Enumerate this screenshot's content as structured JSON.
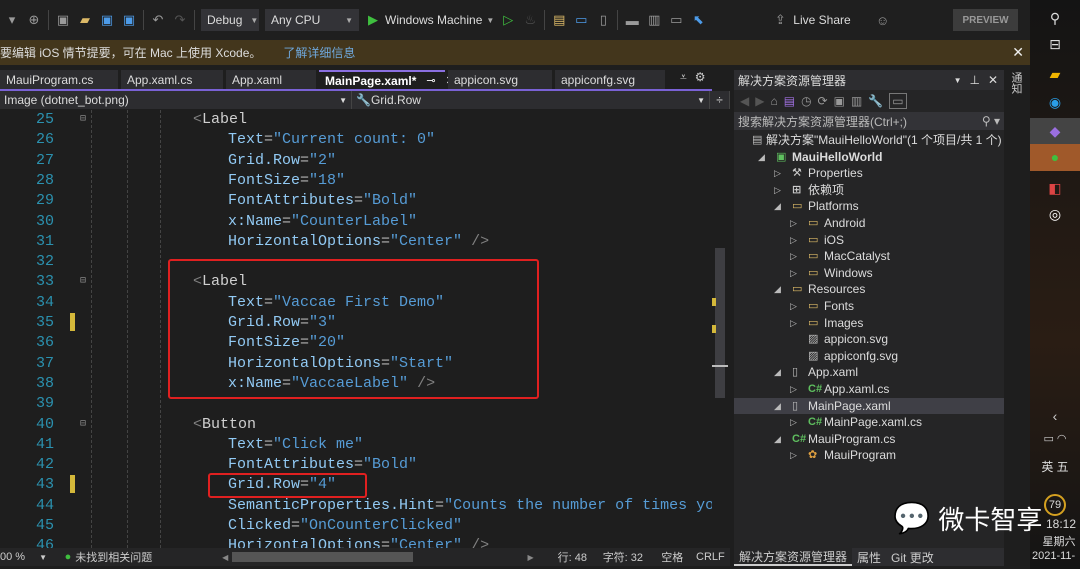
{
  "toolbar": {
    "config": "Debug",
    "platform": "Any CPU",
    "run_target": "Windows Machine",
    "live_share": "Live Share",
    "preview": "PREVIEW"
  },
  "infobar": {
    "message": "要编辑 iOS 情节提要，可在 Mac 上使用 Xcode。",
    "link": "了解详细信息"
  },
  "tabs": [
    {
      "label": "MauiProgram.cs"
    },
    {
      "label": "App.xaml.cs"
    },
    {
      "label": "App.xaml"
    },
    {
      "label": "MainPage.xaml*",
      "active": true
    },
    {
      "label": "appicon.svg"
    },
    {
      "label": "appiconfg.svg"
    }
  ],
  "navbar": {
    "element": "Image (dotnet_bot.png)",
    "member": "Grid.Row"
  },
  "code": [
    {
      "n": "25",
      "tag": "Label",
      "fold": true
    },
    {
      "n": "26",
      "attr": "Text",
      "val": "\"Current count: 0\""
    },
    {
      "n": "27",
      "attr": "Grid.Row",
      "val": "\"2\""
    },
    {
      "n": "28",
      "attr": "FontSize",
      "val": "\"18\""
    },
    {
      "n": "29",
      "attr": "FontAttributes",
      "val": "\"Bold\""
    },
    {
      "n": "30",
      "attr": "x:Name",
      "val": "\"CounterLabel\""
    },
    {
      "n": "31",
      "attr": "HorizontalOptions",
      "val": "\"Center\"",
      "close": " />"
    },
    {
      "n": "32"
    },
    {
      "n": "33",
      "tag": "Label",
      "fold": true
    },
    {
      "n": "34",
      "attr": "Text",
      "val": "\"Vaccae First Demo\""
    },
    {
      "n": "35",
      "attr": "Grid.Row",
      "val": "\"3\"",
      "changed": true
    },
    {
      "n": "36",
      "attr": "FontSize",
      "val": "\"20\""
    },
    {
      "n": "37",
      "attr": "HorizontalOptions",
      "val": "\"Start\""
    },
    {
      "n": "38",
      "attr": "x:Name",
      "val": "\"VaccaeLabel\"",
      "close": " />"
    },
    {
      "n": "39"
    },
    {
      "n": "40",
      "tag": "Button",
      "fold": true
    },
    {
      "n": "41",
      "attr": "Text",
      "val": "\"Click me\""
    },
    {
      "n": "42",
      "attr": "FontAttributes",
      "val": "\"Bold\""
    },
    {
      "n": "43",
      "attr": "Grid.Row",
      "val": "\"4\"",
      "changed": true
    },
    {
      "n": "44",
      "attr": "SemanticProperties.Hint",
      "val": "\"Counts the number of times you"
    },
    {
      "n": "45",
      "attr": "Clicked",
      "val": "\"OnCounterClicked\""
    },
    {
      "n": "46",
      "attr": "HorizontalOptions",
      "val": "\"Center\"",
      "close": " />"
    }
  ],
  "status": {
    "zoom": "00 %",
    "issues": "未找到相关问题",
    "line": "行: 48",
    "char": "字符: 32",
    "spaces": "空格",
    "eol": "CRLF"
  },
  "solution_explorer": {
    "title": "解决方案资源管理器",
    "search_placeholder": "搜索解决方案资源管理器(Ctrl+;)",
    "items": [
      {
        "label": "解决方案\"MauiHelloWorld\"(1 个项目/共 1 个)",
        "level": 0,
        "icon": "solution-icon",
        "exp": ""
      },
      {
        "label": "MauiHelloWorld",
        "level": 0,
        "icon": "csproj-icon",
        "exp": "open",
        "bold": true
      },
      {
        "label": "Properties",
        "level": 1,
        "icon": "properties-icon",
        "exp": "closed"
      },
      {
        "label": "依赖项",
        "level": 1,
        "icon": "dependencies-icon",
        "exp": "closed"
      },
      {
        "label": "Platforms",
        "level": 1,
        "icon": "folder-open-icon",
        "exp": "open"
      },
      {
        "label": "Android",
        "level": 2,
        "icon": "folder-icon",
        "exp": "closed"
      },
      {
        "label": "iOS",
        "level": 2,
        "icon": "folder-icon",
        "exp": "closed"
      },
      {
        "label": "MacCatalyst",
        "level": 2,
        "icon": "folder-icon",
        "exp": "closed"
      },
      {
        "label": "Windows",
        "level": 2,
        "icon": "folder-icon",
        "exp": "closed"
      },
      {
        "label": "Resources",
        "level": 1,
        "icon": "folder-open-icon",
        "exp": "open"
      },
      {
        "label": "Fonts",
        "level": 2,
        "icon": "folder-icon",
        "exp": "closed"
      },
      {
        "label": "Images",
        "level": 2,
        "icon": "folder-icon",
        "exp": "closed"
      },
      {
        "label": "appicon.svg",
        "level": 2,
        "icon": "image-file-icon",
        "exp": ""
      },
      {
        "label": "appiconfg.svg",
        "level": 2,
        "icon": "image-file-icon",
        "exp": ""
      },
      {
        "label": "App.xaml",
        "level": 1,
        "icon": "xaml-file-icon",
        "exp": "open"
      },
      {
        "label": "App.xaml.cs",
        "level": 2,
        "icon": "csharp-file-icon",
        "exp": "closed"
      },
      {
        "label": "MainPage.xaml",
        "level": 1,
        "icon": "xaml-file-icon",
        "exp": "open",
        "selected": true
      },
      {
        "label": "MainPage.xaml.cs",
        "level": 2,
        "icon": "csharp-file-icon",
        "exp": "closed"
      },
      {
        "label": "MauiProgram.cs",
        "level": 1,
        "icon": "csharp-file-icon",
        "exp": "open"
      },
      {
        "label": "MauiProgram",
        "level": 2,
        "icon": "class-icon",
        "exp": "closed"
      }
    ],
    "bottom_tabs": [
      "解决方案资源管理器",
      "属性",
      "Git 更改"
    ]
  },
  "side_tab": "通知",
  "taskbar": {
    "lang": "英",
    "ime": "五",
    "battery": "79",
    "time": "18:12",
    "weekday": "星期六",
    "date": "2021-11-"
  },
  "watermark": "微卡智享",
  "colors": {
    "accent": "#7a62d6",
    "highlight_box": "#e02020",
    "infobar": "#43361c"
  }
}
